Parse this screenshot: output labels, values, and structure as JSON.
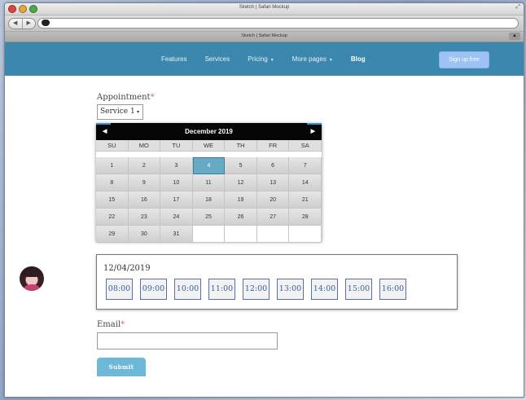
{
  "browser": {
    "title": "Sketch | Safari Mockup",
    "tab_title": "Sketch | Safari Mockup",
    "back_arrow": "◀",
    "forward_arrow": "▶"
  },
  "site": {
    "nav": [
      {
        "label": "Features",
        "dropdown": false
      },
      {
        "label": "Services",
        "dropdown": false
      },
      {
        "label": "Pricing",
        "dropdown": true
      },
      {
        "label": "More pages",
        "dropdown": true
      },
      {
        "label": "Blog",
        "dropdown": false
      }
    ],
    "signup_label": "Sign up free"
  },
  "form": {
    "appointment_label": "Appointment",
    "required_mark": "*",
    "service_value": "Service 1",
    "select_arrow": "▾",
    "calendar": {
      "month": "December 2019",
      "prev": "◀",
      "next": "▶",
      "weekdays": [
        "SU",
        "MO",
        "TU",
        "WE",
        "TH",
        "FR",
        "SA"
      ],
      "weeks": [
        [
          "1",
          "2",
          "3",
          "4",
          "5",
          "6",
          "7"
        ],
        [
          "8",
          "9",
          "10",
          "11",
          "12",
          "13",
          "14"
        ],
        [
          "15",
          "16",
          "17",
          "18",
          "19",
          "20",
          "21"
        ],
        [
          "22",
          "23",
          "24",
          "25",
          "26",
          "27",
          "28"
        ],
        [
          "29",
          "30",
          "31",
          "",
          "",
          "",
          ""
        ]
      ],
      "selected_day": "4"
    },
    "selected_date": "12/04/2019",
    "time_slots": [
      "08:00",
      "09:00",
      "10:00",
      "11:00",
      "12:00",
      "13:00",
      "14:00",
      "15:00",
      "16:00"
    ],
    "email_label": "Email",
    "submit_label": "Submit"
  },
  "colors": {
    "nav_bg": "#3b87ad",
    "signup_bg": "#9ec2f3",
    "selected_day_bg": "#66aac5",
    "submit_bg": "#6db7d8",
    "slot_text": "#3464a5"
  }
}
